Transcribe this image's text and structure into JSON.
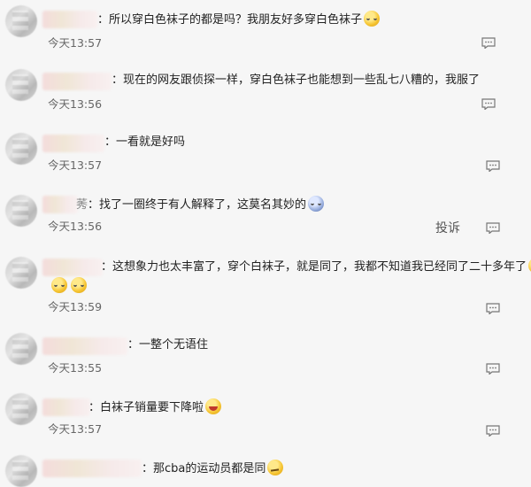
{
  "comments": [
    {
      "text": "：所以穿白色袜子的都是吗？我朋友好多穿白色袜子",
      "time": "今天13:57",
      "emojis": [
        "cry-laugh-icon"
      ]
    },
    {
      "text": "：现在的网友跟侦探一样，穿白色袜子也能想到一些乱七八糟的，我服了",
      "time": "今天13:56"
    },
    {
      "text": "：一看就是好吗",
      "time": "今天13:57"
    },
    {
      "name_tail": "莠",
      "text": "：找了一圈终于有人解释了，这莫名其妙的",
      "time": "今天13:56",
      "report_label": "投诉",
      "emojis": [
        "dizzy-face-icon"
      ]
    },
    {
      "text": "：这想象力也太丰富了，穿个白袜子，就是同了，我都不知道我已经同了二十多年了",
      "time": "今天13:59",
      "emojis": [
        "cry-laugh-icon",
        "cry-laugh-icon",
        "cry-laugh-icon"
      ]
    },
    {
      "text": "：一整个无语住",
      "time": "今天13:55"
    },
    {
      "text": "：白袜子销量要下降啦",
      "time": "今天13:57",
      "emojis": [
        "laughing-icon"
      ]
    },
    {
      "text": "：那cba的运动员都是同",
      "time": "",
      "emojis": [
        "smirk-icon"
      ]
    }
  ],
  "colors": {
    "background": "#f6f6f6",
    "text": "#222222",
    "time": "#666666",
    "icon": "#777777"
  }
}
